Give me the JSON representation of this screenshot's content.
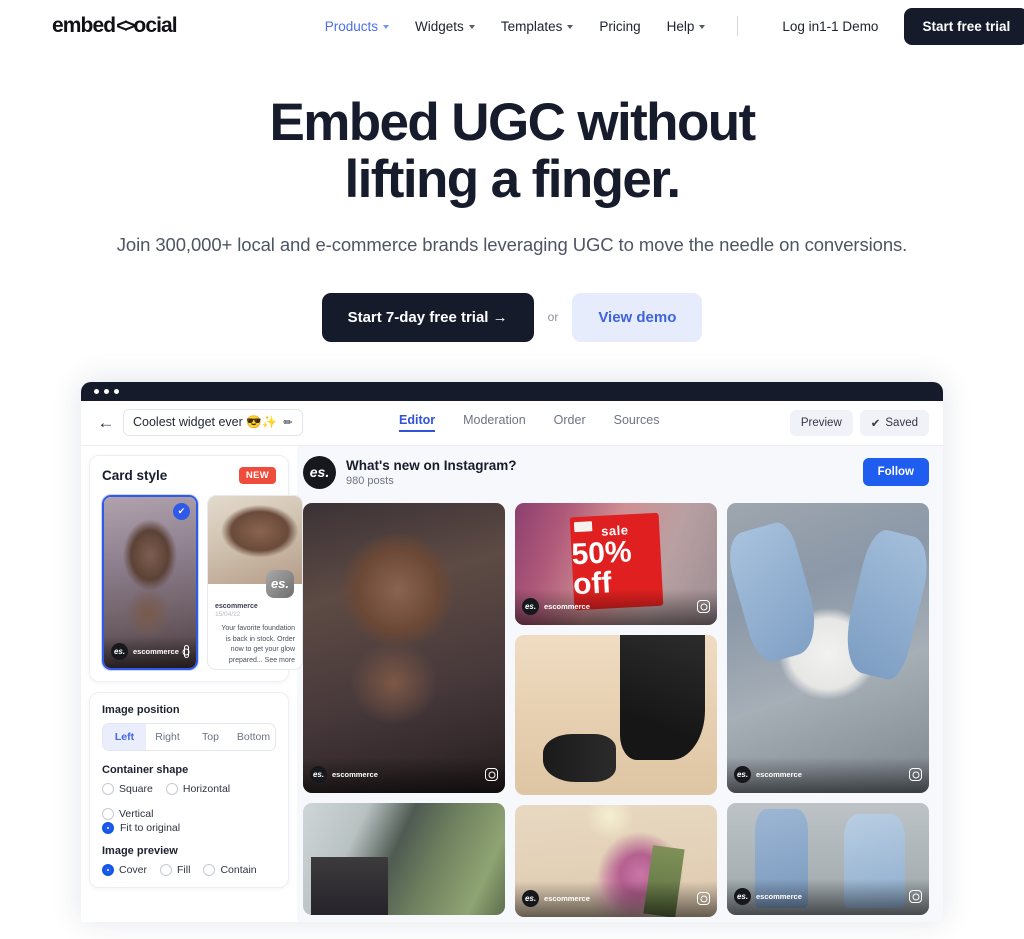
{
  "nav": {
    "logo": {
      "pre": "embed",
      "chevron": "<>",
      "post": "ocial"
    },
    "links": [
      {
        "label": "Products",
        "has_caret": true,
        "active": true
      },
      {
        "label": "Widgets",
        "has_caret": true,
        "active": false
      },
      {
        "label": "Templates",
        "has_caret": true,
        "active": false
      },
      {
        "label": "Pricing",
        "has_caret": false,
        "active": false
      },
      {
        "label": "Help",
        "has_caret": true,
        "active": false
      }
    ],
    "login": "Log in",
    "demo": "1-1 Demo",
    "trial_button": "Start free trial",
    "accent_color": "#4b6fe8",
    "dark_color": "#161b2c"
  },
  "hero": {
    "title_line1": "Embed UGC without",
    "title_line2": "lifting a finger.",
    "subtitle": "Join 300,000+ local and e-commerce brands leveraging UGC to move the needle on conversions.",
    "primary_cta": "Start 7-day free trial  →",
    "or": "or",
    "secondary_cta": "View demo"
  },
  "app": {
    "toolbar": {
      "back_icon": "←",
      "widget_name": "Coolest widget ever 😎✨",
      "edit_icon": "✏",
      "tabs": [
        {
          "label": "Editor",
          "active": true
        },
        {
          "label": "Moderation",
          "active": false
        },
        {
          "label": "Order",
          "active": false
        },
        {
          "label": "Sources",
          "active": false
        }
      ],
      "preview_button": "Preview",
      "saved_button": "Saved",
      "saved_check": "✔"
    },
    "sidebar": {
      "card_style": {
        "title": "Card style",
        "badge": "NEW",
        "selected_check": "✔",
        "card1": {
          "handle": "escommerce"
        },
        "card2": {
          "logo": "es.",
          "user": "escommerce",
          "date": "15/04/22",
          "caption": "Your favorite foundation is back in stock. Order now to get your glow prepared... See more"
        }
      },
      "image_position": {
        "label": "Image position",
        "options": [
          "Left",
          "Right",
          "Top",
          "Bottom"
        ],
        "selected": "Left"
      },
      "container_shape": {
        "label": "Container shape",
        "options": [
          "Square",
          "Horizontal",
          "Vertical",
          "Fit to original"
        ],
        "selected": "Fit to original"
      },
      "image_preview": {
        "label": "Image preview",
        "options": [
          "Cover",
          "Fill",
          "Contain"
        ],
        "selected": "Cover"
      }
    },
    "feed": {
      "avatar": "es.",
      "title": "What's new on Instagram?",
      "posts": "980 posts",
      "follow_button": "Follow",
      "tiles": [
        {
          "id": "portrait-makeup",
          "handle": "escommerce",
          "network": "instagram"
        },
        {
          "id": "sale-rack",
          "handle": "escommerce",
          "network": "instagram",
          "sale_top": "sale",
          "sale_big": "50% off"
        },
        {
          "id": "denim-jump",
          "handle": "escommerce",
          "network": "instagram"
        },
        {
          "id": "sneakers",
          "handle": "",
          "network": ""
        },
        {
          "id": "store-window",
          "handle": "",
          "network": ""
        },
        {
          "id": "flowers",
          "handle": "escommerce",
          "network": "instagram"
        },
        {
          "id": "denim-group",
          "handle": "escommerce",
          "network": "instagram"
        }
      ]
    }
  }
}
